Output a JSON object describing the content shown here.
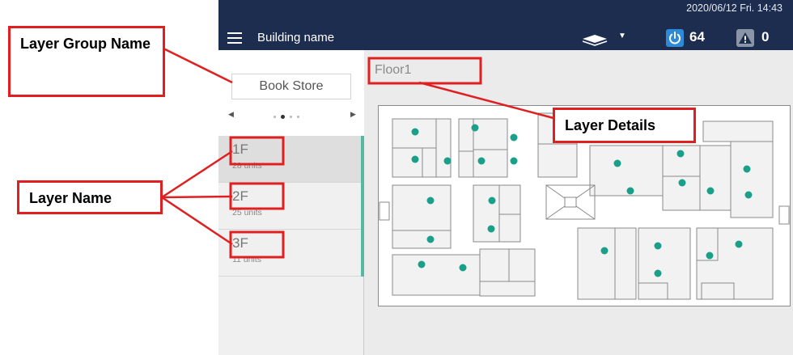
{
  "header": {
    "datetime": "2020/06/12 Fri. 14:43",
    "building_name": "Building name",
    "power_count": "64",
    "alert_count": "0"
  },
  "sidebar": {
    "group_name": "Book Store",
    "pager": {
      "total": 4,
      "active": 1
    },
    "layers": [
      {
        "name": "1F",
        "units": "28 units",
        "selected": true
      },
      {
        "name": "2F",
        "units": "25 units",
        "selected": false
      },
      {
        "name": "3F",
        "units": "11 units",
        "selected": false
      }
    ]
  },
  "main": {
    "floor_title": "Floor1"
  },
  "annotations": {
    "layer_group_name": "Layer Group Name",
    "layer_name": "Layer Name",
    "layer_details": "Layer Details"
  },
  "colors": {
    "header_bg": "#1d2d4f",
    "accent": "#55b9a6",
    "unit_dot": "#1aa089",
    "annotation_red": "#e02020",
    "power_badge": "#2e8ad6"
  }
}
